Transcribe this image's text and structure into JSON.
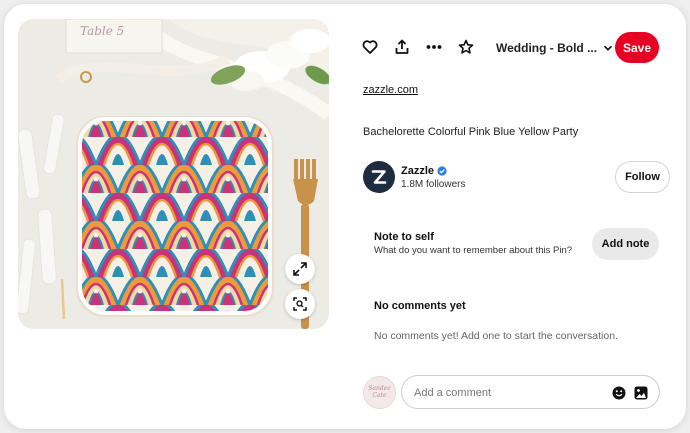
{
  "toolbar": {
    "board_name": "Wedding - Bold ...",
    "save_label": "Save"
  },
  "pin": {
    "source": "zazzle.com",
    "title": "Bachelorette Colorful Pink Blue Yellow Party",
    "place_card_text": "Table 5"
  },
  "creator": {
    "name": "Zazzle",
    "followers": "1.8M followers",
    "follow_label": "Follow"
  },
  "note": {
    "title": "Note to self",
    "prompt": "What do you want to remember about this Pin?",
    "button_label": "Add note"
  },
  "comments": {
    "heading": "No comments yet",
    "empty_text": "No comments yet! Add one to start the conversation.",
    "input_placeholder": "Add a comment",
    "avatar_text": "Sandee Cate"
  },
  "colors": {
    "save_red": "#e60023",
    "zazzle_navy": "#1f2c3f",
    "plate_pink": "#c8337a",
    "plate_orange": "#ec9a3a",
    "plate_blue": "#2f8fb6"
  }
}
